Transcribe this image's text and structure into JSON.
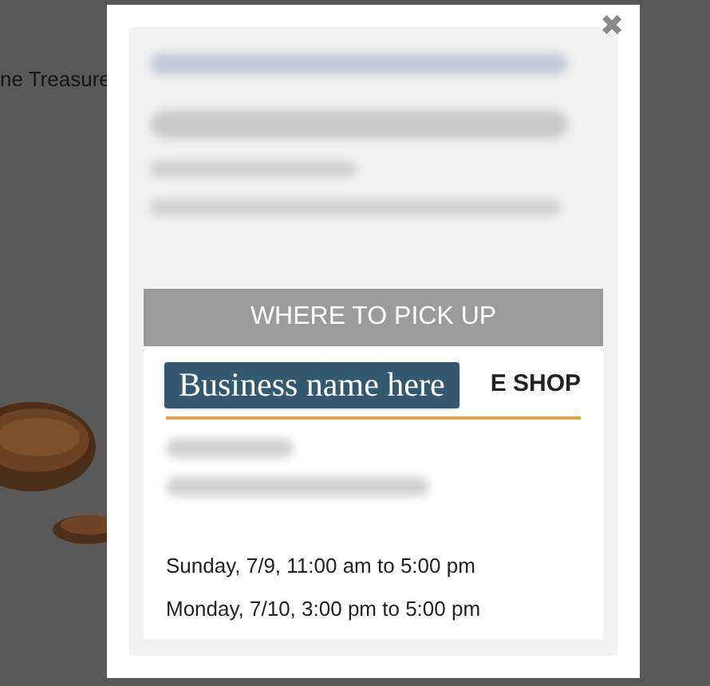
{
  "background_page": {
    "heading_fragment": "ne Treasure"
  },
  "modal": {
    "close": "✖",
    "blurred_lines": [
      {
        "kind": "link"
      },
      {
        "kind": "heading"
      },
      {
        "kind": "text"
      },
      {
        "kind": "text"
      }
    ],
    "pickup": {
      "header": "WHERE TO PICK UP",
      "badge": "Business name here",
      "shop_name_fragment": "E SHOP",
      "blurred_address_lines": [
        {
          "kind": "short"
        },
        {
          "kind": "long"
        }
      ],
      "times": [
        "Sunday, 7/9, 11:00 am to 5:00 pm",
        "Monday, 7/10, 3:00 pm to 5:00 pm"
      ]
    }
  }
}
